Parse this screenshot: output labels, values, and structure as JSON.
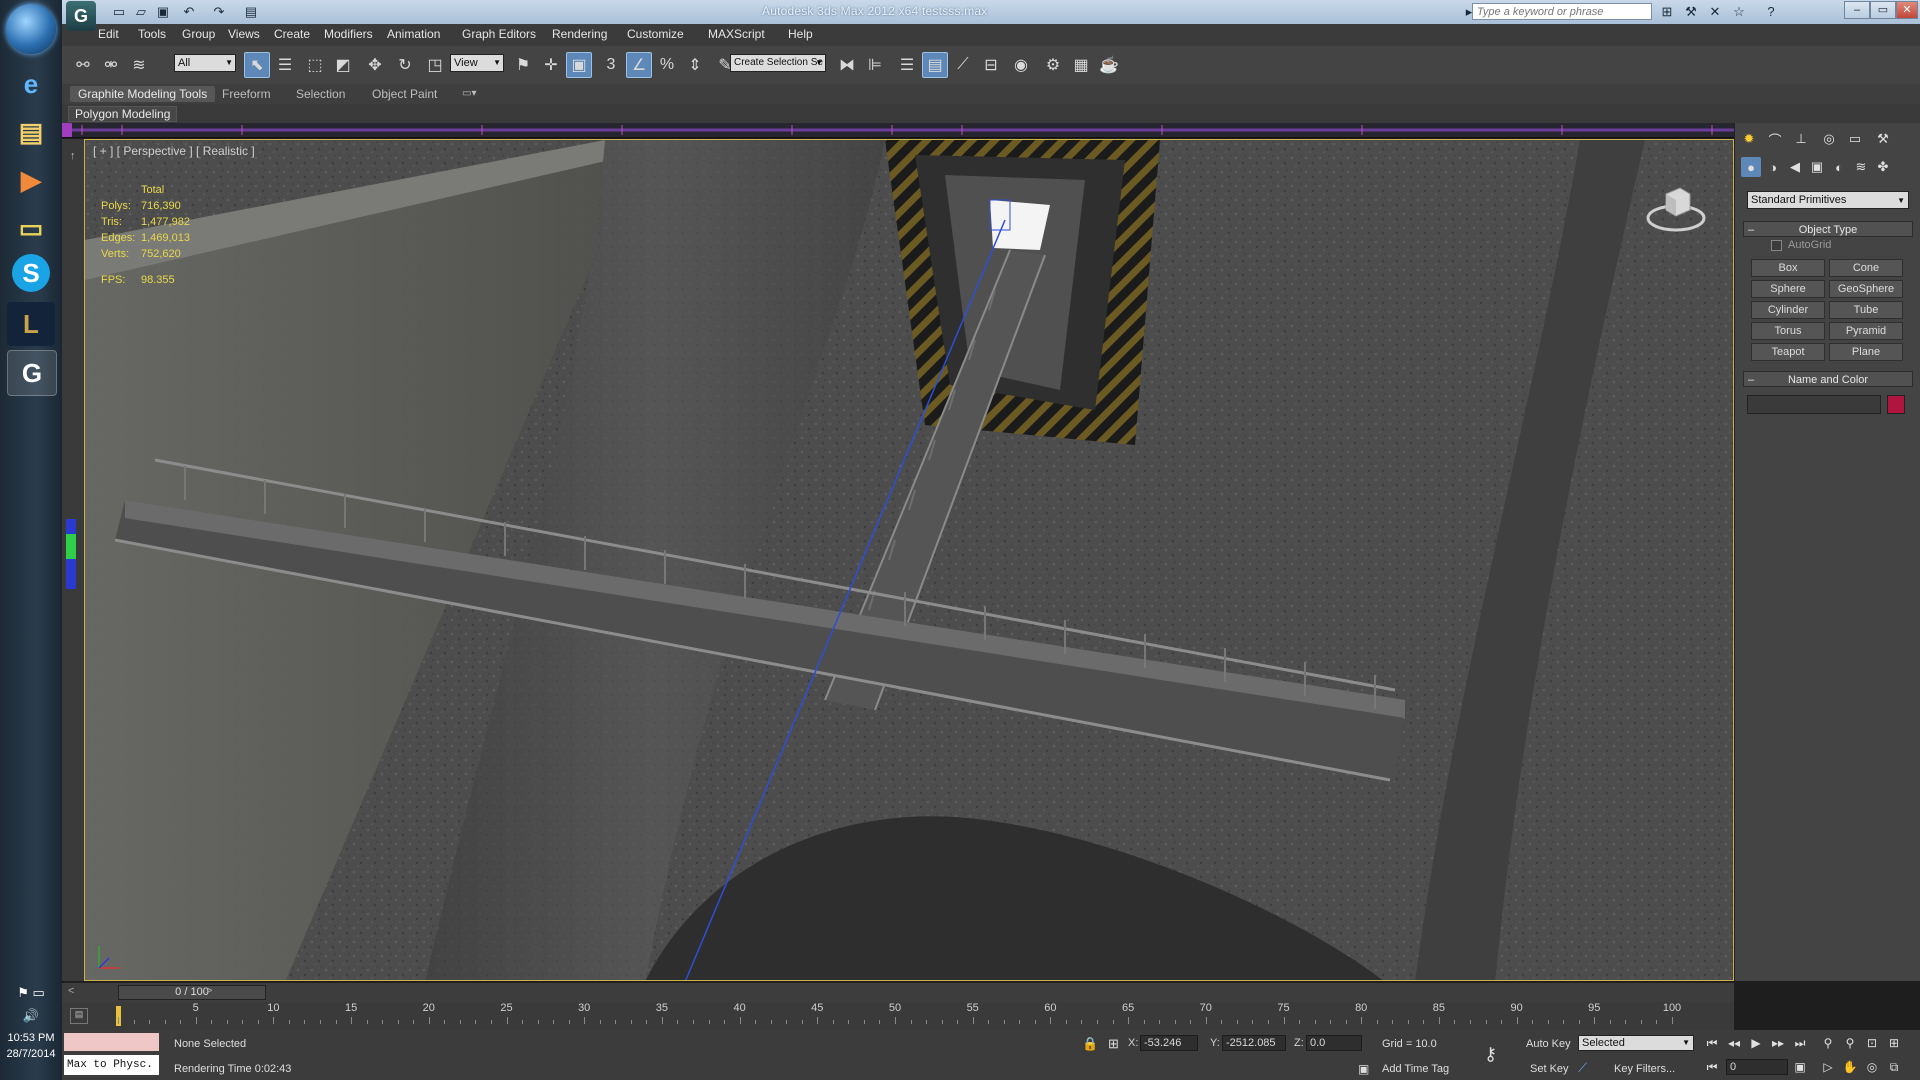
{
  "taskbar": {
    "apps": [
      {
        "name": "internet-explorer",
        "glyph": "e"
      },
      {
        "name": "file-explorer",
        "glyph": "▤"
      },
      {
        "name": "media-player",
        "glyph": "▶"
      },
      {
        "name": "folder",
        "glyph": "▭"
      },
      {
        "name": "skype",
        "glyph": "S"
      },
      {
        "name": "league-of-legends",
        "glyph": "L"
      },
      {
        "name": "3ds-max",
        "glyph": "G"
      }
    ],
    "clock_time": "10:53 PM",
    "clock_date": "28/7/2014"
  },
  "window": {
    "title": "Autodesk 3ds Max 2012 x64      testsss.max",
    "search_placeholder": "Type a keyword or phrase",
    "logo_glyph": "G"
  },
  "menu": {
    "items": [
      "Edit",
      "Tools",
      "Group",
      "Views",
      "Create",
      "Modifiers",
      "Animation",
      "Graph Editors",
      "Rendering",
      "Customize",
      "MAXScript",
      "Help"
    ]
  },
  "toolbar": {
    "selection_filter": "All",
    "ref_coord": "View",
    "snap_label": "3",
    "named_selection_placeholder": "Create Selection Se"
  },
  "ribbon": {
    "tabs": [
      "Graphite Modeling Tools",
      "Freeform",
      "Selection",
      "Object Paint"
    ],
    "active_panel": "Polygon Modeling"
  },
  "viewport": {
    "label": "[ + ] [ Perspective ] [ Realistic ]",
    "stats_header": "Total",
    "stats": [
      {
        "label": "Polys:",
        "value": "716,390"
      },
      {
        "label": "Tris:",
        "value": "1,477,982"
      },
      {
        "label": "Edges:",
        "value": "1,469,013"
      },
      {
        "label": "Verts:",
        "value": "752,620"
      }
    ],
    "fps_label": "FPS:",
    "fps_value": "98.355"
  },
  "command_panel": {
    "category": "Standard Primitives",
    "object_type_title": "Object Type",
    "autogrid_label": "AutoGrid",
    "buttons": [
      "Box",
      "Cone",
      "Sphere",
      "GeoSphere",
      "Cylinder",
      "Tube",
      "Torus",
      "Pyramid",
      "Teapot",
      "Plane"
    ],
    "name_color_title": "Name and Color",
    "color": "#b01540"
  },
  "timeline": {
    "frame_display": "0 / 100",
    "ticks": [
      "5",
      "10",
      "15",
      "20",
      "25",
      "30",
      "35",
      "40",
      "45",
      "50",
      "55",
      "60",
      "65",
      "70",
      "75",
      "80",
      "85",
      "90",
      "95",
      "100"
    ]
  },
  "status": {
    "listener_text": "Max to Physc.",
    "selection_status": "None Selected",
    "render_time": "Rendering Time  0:02:43",
    "x_label": "X:",
    "x_value": "-53.246",
    "y_label": "Y:",
    "y_value": "-2512.085",
    "z_label": "Z:",
    "z_value": "0.0",
    "grid": "Grid = 10.0",
    "add_time_tag": "Add Time Tag",
    "auto_key": "Auto Key",
    "set_key": "Set Key",
    "key_mode": "Selected",
    "key_filters": "Key Filters...",
    "frame_field": "0"
  },
  "colors": {
    "viewport_border": "#c9b24a",
    "stats_text": "#e8d94a",
    "active_tool": "#5d88b8"
  }
}
